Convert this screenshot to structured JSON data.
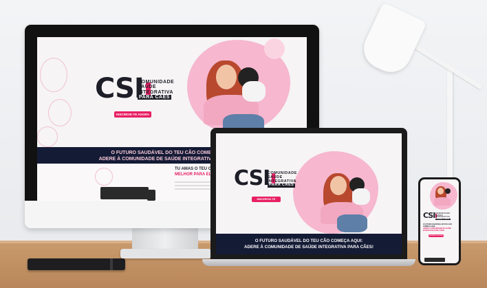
{
  "site": {
    "logo_main": "CSI",
    "tagline_line1": "COMUNIDADE",
    "tagline_line2": "SAÚDE",
    "tagline_line3": "INTEGRATIVA",
    "tagline_box": "PARA CÃES",
    "cta_label": "INSCREVE-TE AGORA",
    "banner_line1": "O FUTURO SAUDÁVEL DO TEU CÃO COMEÇA AQUI:",
    "banner_line2": "ADERE À COMUNIDADE DE SAÚDE INTEGRATIVA PARA CÃES!",
    "section2_title_line1": "TU AMAS O TEU CÃO",
    "section2_title_line2": "MELHOR PARA ELE, C"
  },
  "colors": {
    "accent": "#e81f63",
    "navy": "#141b35",
    "blob": "#f6b7cf"
  }
}
